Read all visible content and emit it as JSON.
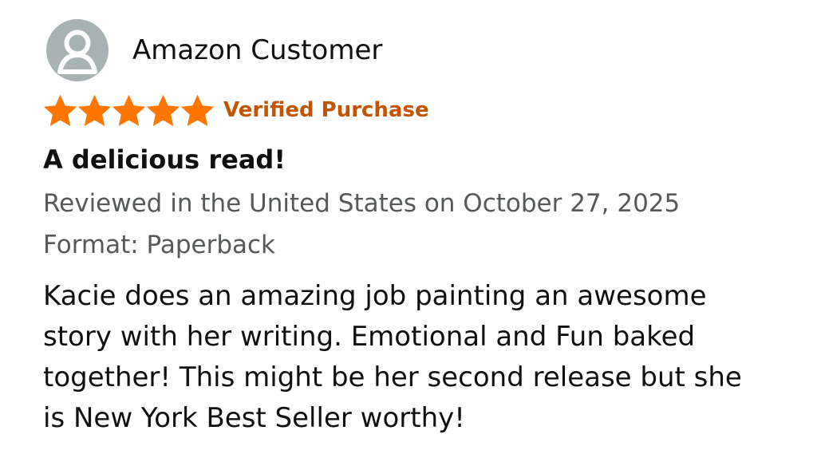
{
  "review": {
    "reviewer_name": "Amazon Customer",
    "rating": 5,
    "rating_max": 5,
    "verified_label": "Verified Purchase",
    "title": "A delicious read!",
    "review_date": "Reviewed in the United States on October 27, 2025",
    "format": "Format: Paperback",
    "body": "Kacie does an amazing job painting an awesome story with her writing. Emotional and Fun baked together! This might be her second release but she is New York Best Seller worthy!"
  },
  "icons": {
    "avatar": "user-icon",
    "star": "star-icon"
  },
  "colors": {
    "background": "#ffffff",
    "text": "#0f1111",
    "secondary_text": "#565959",
    "verified": "#c45500",
    "star": "#ff7700",
    "avatar": "#a9b2b3"
  }
}
